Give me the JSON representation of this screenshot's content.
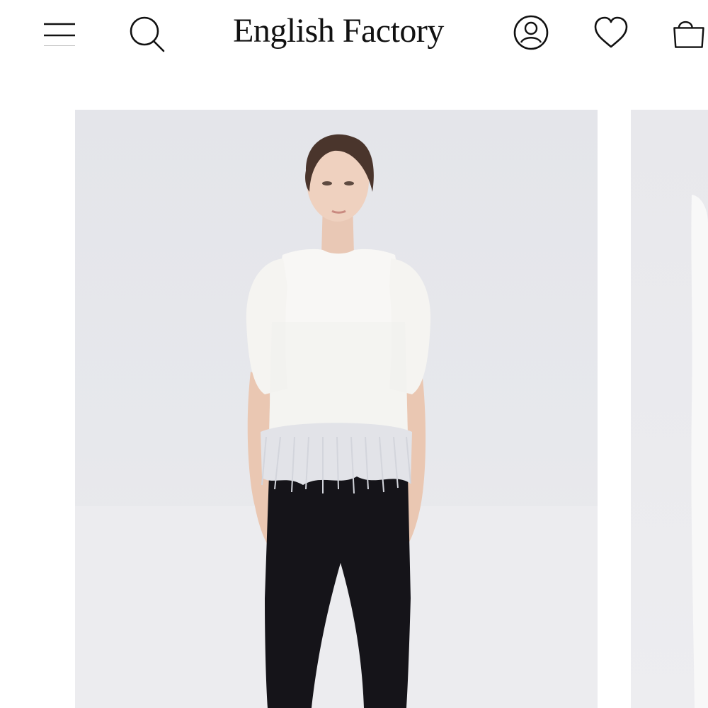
{
  "header": {
    "brand": "English Factory",
    "icons": {
      "menu": "hamburger-menu-icon",
      "search": "search-icon",
      "account": "account-icon",
      "wishlist": "heart-icon",
      "bag": "shopping-bag-icon"
    }
  },
  "product": {
    "image_subject": "model-white-feather-trim-top",
    "next_image_subject": "partial-next-product-image"
  },
  "colors": {
    "text": "#111111",
    "background": "#ffffff",
    "image_backdrop": "#e6e7eb"
  }
}
